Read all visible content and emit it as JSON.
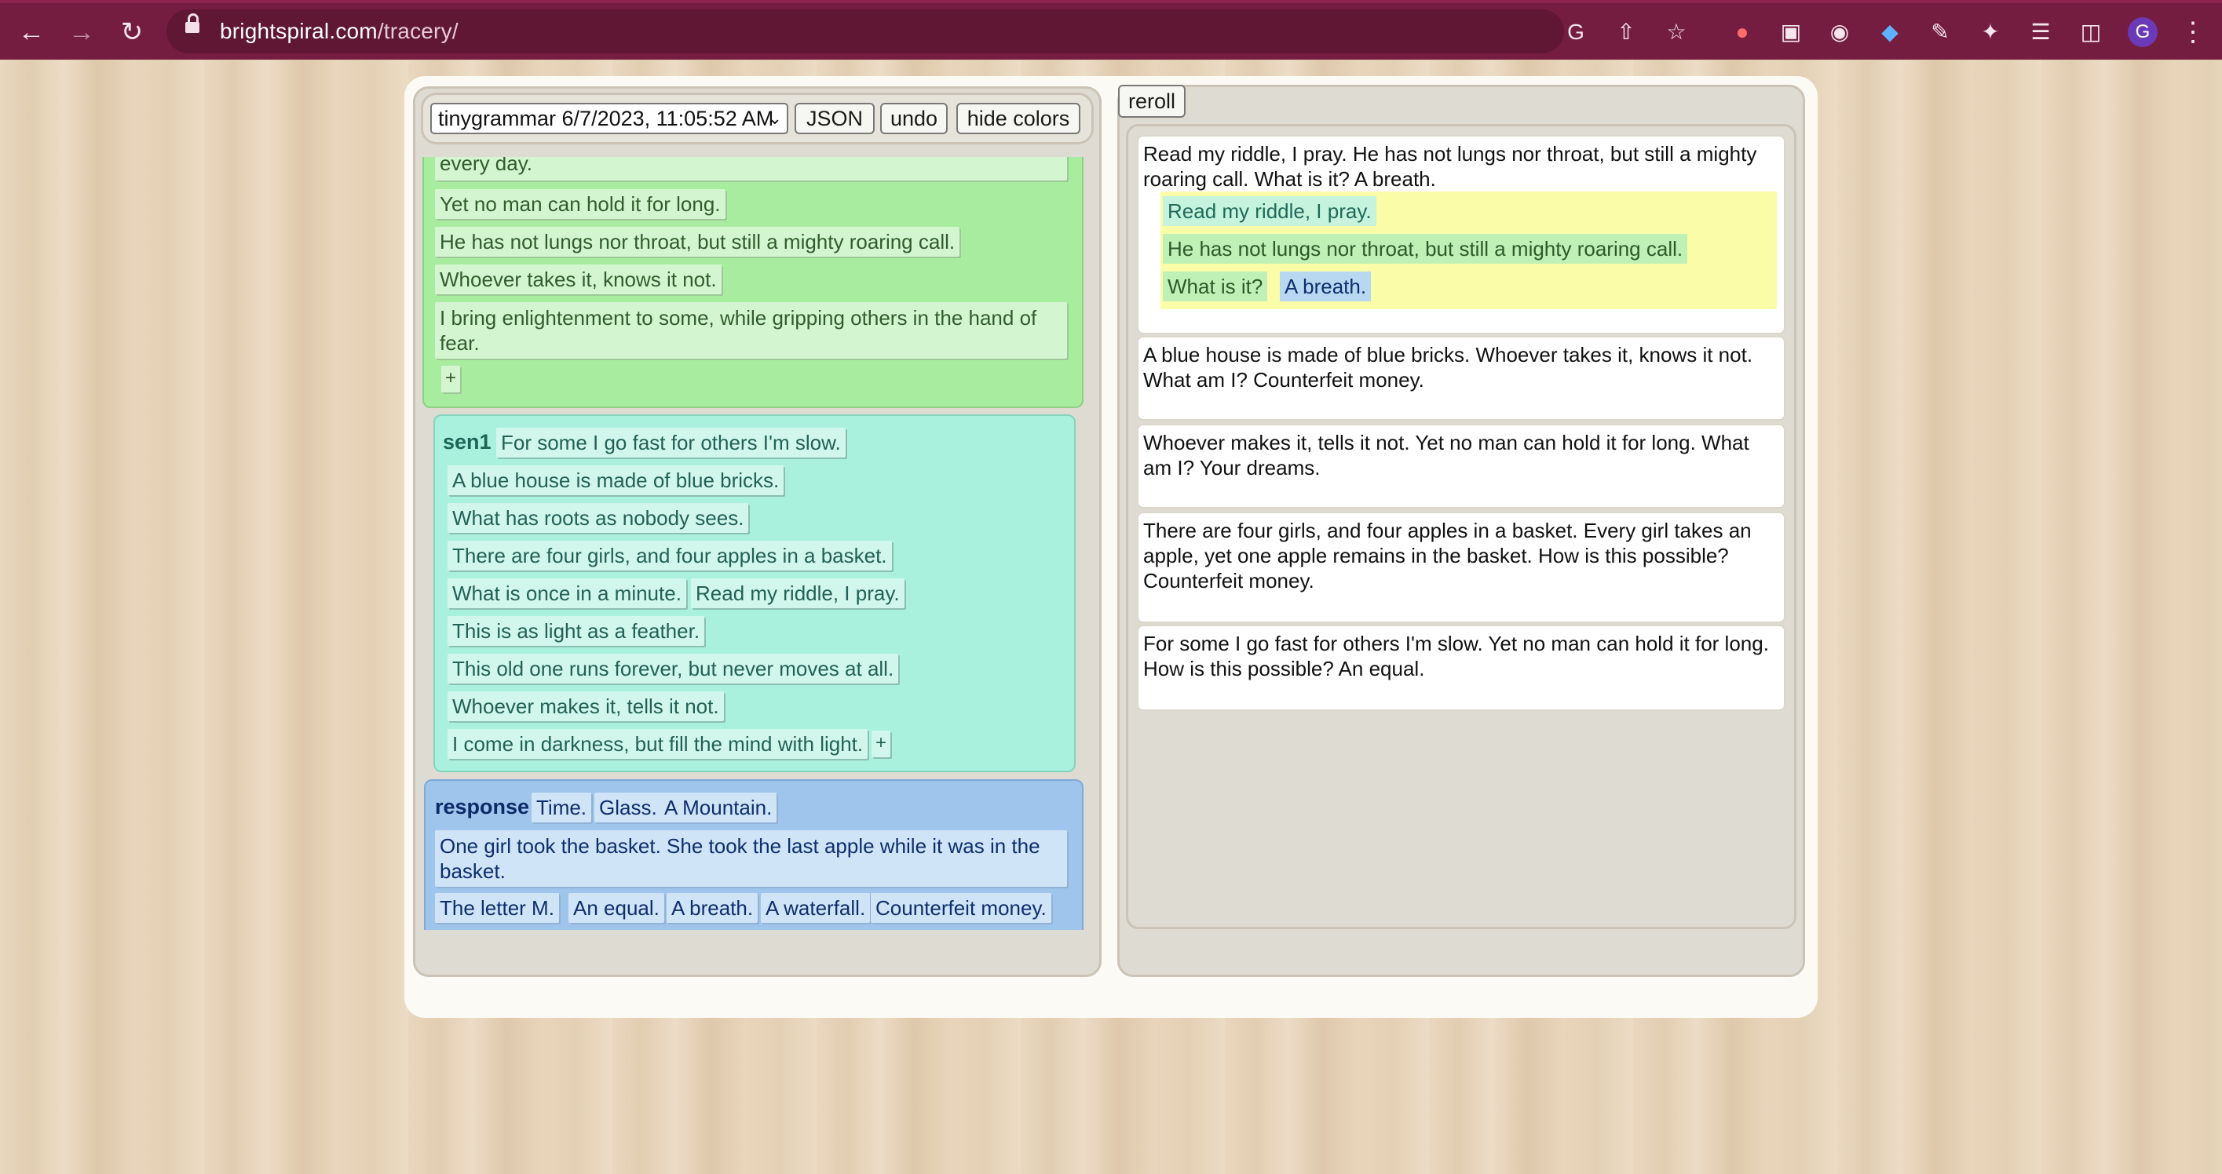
{
  "browser": {
    "url_domain": "brightspiral.com",
    "url_path": "/tracery/",
    "profile_initial": "G"
  },
  "controls": {
    "grammar_select": "tinygrammar 6/7/2023, 11:05:52 AM",
    "json_label": "JSON",
    "undo_label": "undo",
    "hide_colors_label": "hide colors",
    "reroll_label": "reroll"
  },
  "green_rule": {
    "partial_item": "every day.",
    "items": [
      "Yet no man can hold it for long.",
      "He has not lungs nor throat, but still a mighty roaring call.",
      "Whoever takes it, knows it not.",
      "I bring enlightenment to some, while gripping others in the hand of fear."
    ],
    "add": "+"
  },
  "sen1_rule": {
    "name": "sen1",
    "items": [
      "For some I go fast for others I'm slow.",
      "A blue house is made of blue bricks.",
      "What has roots as nobody sees.",
      "There are four girls, and four apples in a basket.",
      "What is once in a minute.",
      "Read my riddle, I pray.",
      "This is as light as a feather.",
      "This old one runs forever, but never moves at all.",
      "Whoever makes it, tells it not.",
      "I come in darkness, but fill the mind with light."
    ],
    "add": "+"
  },
  "response_rule": {
    "name": "response",
    "items": [
      "Time.",
      "Glass.",
      "A Mountain.",
      "One girl took the basket. She took the last apple while it was in the basket.",
      "The letter M.",
      "An equal.",
      "A breath.",
      "A waterfall.",
      "Counterfeit money."
    ]
  },
  "outputs": [
    "Read my riddle, I pray. He has not lungs nor throat, but still a mighty roaring call. What is it? A breath.",
    "A blue house is made of blue bricks. Whoever takes it, knows it not. What am I? Counterfeit money.",
    "Whoever makes it, tells it not. Yet no man can hold it for long. What am I? Your dreams.",
    "There are four girls, and four apples in a basket. Every girl takes an apple, yet one apple remains in the basket. How is this possible? Counterfeit money.",
    "For some I go fast for others I'm slow. Yet no man can hold it for long. How is this possible? An equal."
  ],
  "trace": {
    "line1": "Read my riddle, I pray.",
    "line2": "He has not lungs nor throat, but still a mighty roaring call.",
    "question": "What is it?",
    "answer": "A breath."
  },
  "colors": {
    "chrome": "#751d41",
    "green_rule": "#a8ec9f",
    "sen1_rule": "#a9f1dd",
    "response_rule": "#9fc5ec",
    "trace_highlight": "#fbfca8"
  }
}
